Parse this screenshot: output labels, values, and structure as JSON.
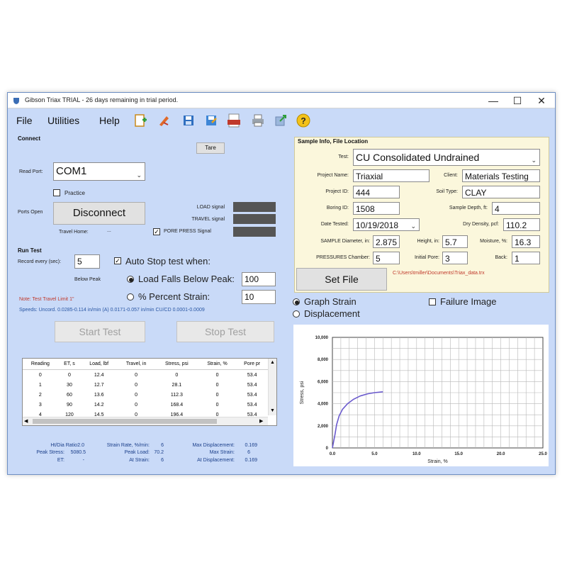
{
  "window": {
    "title": "Gibson Triax TRIAL - 26 days remaining in trial period.",
    "min_glyph": "—",
    "max_glyph": "☐",
    "close_glyph": "✕"
  },
  "menu": [
    "File",
    "Utilities",
    "Help"
  ],
  "toolbar_icons": [
    "new-file-icon",
    "edit-icon",
    "save-icon",
    "save-as-icon",
    "pdf-icon",
    "print-icon",
    "export-icon",
    "help-icon"
  ],
  "connect": {
    "header": "Connect",
    "tare": "Tare",
    "read_port_label": "Read Port:",
    "port_value": "COM1",
    "practice_label": "Practice",
    "ports_open_label": "Ports Open",
    "disconnect": "Disconnect",
    "travel_home_label": "Travel Home:",
    "travel_home_value": "...",
    "load_signal": "LOAD signal",
    "travel_signal": "TRAVEL signal",
    "pore_press_signal": "PORE PRESS Signal"
  },
  "run_test": {
    "header": "Run Test",
    "record_every_label": "Record every (sec):",
    "record_every_value": "5",
    "auto_stop_label": "Auto Stop test when:",
    "below_peak_label": "Below Peak",
    "load_falls_label": "Load Falls Below Peak:",
    "load_falls_value": "100",
    "percent_strain_label": "% Percent Strain:",
    "percent_strain_value": "10",
    "note": "Note: Test Travel Limit 1\"",
    "speeds": "Speeds: Uncord. 0.0285-0.114 in/min (A) 0.0171-0.057 in/min CU/CD 0.0001-0.0009",
    "start": "Start Test",
    "stop": "Stop Test"
  },
  "table": {
    "headers": [
      "Reading",
      "ET, s",
      "Load, lbf",
      "Travel, in",
      "Stress, psi",
      "Strain, %",
      "Pore pr"
    ],
    "rows": [
      [
        "0",
        "0",
        "12.4",
        "0",
        "0",
        "0",
        "53.4"
      ],
      [
        "1",
        "30",
        "12.7",
        "0",
        "28.1",
        "0",
        "53.4"
      ],
      [
        "2",
        "60",
        "13.6",
        "0",
        "112.3",
        "0",
        "53.4"
      ],
      [
        "3",
        "90",
        "14.2",
        "0",
        "168.4",
        "0",
        "53.4"
      ],
      [
        "4",
        "120",
        "14.5",
        "0",
        "196.4",
        "0",
        "53.4"
      ]
    ]
  },
  "stats": {
    "ht_dia_label": "Ht/Dia Ratio:",
    "ht_dia_value": "2.0",
    "peak_stress_label": "Peak Stress:",
    "peak_stress_value": "5080.5",
    "et_label": "ET:",
    "et_value": "-",
    "strain_rate_label": "Strain Rate, %/min:",
    "strain_rate_value": "6",
    "peak_load_label": "Peak Load:",
    "peak_load_value": "70.2",
    "at_strain_label": "At Strain:",
    "at_strain_value": "6",
    "max_disp_label": "Max Displacement:",
    "max_disp_value": "0.169",
    "max_strain_label": "Max Strain:",
    "max_strain_value": "6",
    "at_disp_label": "At Displacement:",
    "at_disp_value": "0.169"
  },
  "sample": {
    "header": "Sample Info, File Location",
    "test_label": "Test:",
    "test_value": "CU Consolidated Undrained",
    "project_name_label": "Project Name:",
    "project_name_value": "Triaxial",
    "client_label": "Client:",
    "client_value": "Materials Testing",
    "project_id_label": "Project ID:",
    "project_id_value": "444",
    "soil_type_label": "Soil Type:",
    "soil_type_value": "CLAY",
    "boring_id_label": "Boring ID:",
    "boring_id_value": "1508",
    "sample_depth_label": "Sample Depth, ft:",
    "sample_depth_value": "4",
    "date_tested_label": "Date Tested:",
    "date_tested_value": "10/19/2018",
    "dry_density_label": "Dry Density, pcf:",
    "dry_density_value": "110.2",
    "diameter_label": "SAMPLE Diameter, in:",
    "diameter_value": "2.875",
    "height_label": "Height, in:",
    "height_value": "5.7",
    "moisture_label": "Moisture, %:",
    "moisture_value": "16.3",
    "chamber_label": "PRESSURES Chamber:",
    "chamber_value": "5",
    "initial_pore_label": "Initial Pore:",
    "initial_pore_value": "3",
    "back_label": "Back:",
    "back_value": "1",
    "set_file": "Set File",
    "file_path": "C:\\Users\\tmiller\\Documents\\Triax_data.trx"
  },
  "graph_options": {
    "graph_strain": "Graph Strain",
    "displacement": "Displacement",
    "failure_image": "Failure Image"
  },
  "chart_data": {
    "type": "line",
    "xlabel": "Strain, %",
    "ylabel": "Stress, psi",
    "xlim": [
      0,
      25
    ],
    "ylim": [
      0,
      10000
    ],
    "x_ticks": [
      "0.0",
      "5.0",
      "10.0",
      "15.0",
      "20.0",
      "25.0"
    ],
    "y_ticks": [
      "0",
      "2,000",
      "4,000",
      "6,000",
      "8,000",
      "10,000"
    ],
    "grid": true,
    "color": "#6a5acd",
    "series": [
      {
        "x": [
          0,
          0.3,
          0.5,
          0.8,
          1.2,
          1.8,
          2.5,
          3.3,
          4.2,
          5.0,
          6.0
        ],
        "y": [
          0,
          1200,
          2100,
          2900,
          3500,
          4000,
          4400,
          4700,
          4900,
          5000,
          5080
        ]
      }
    ]
  }
}
